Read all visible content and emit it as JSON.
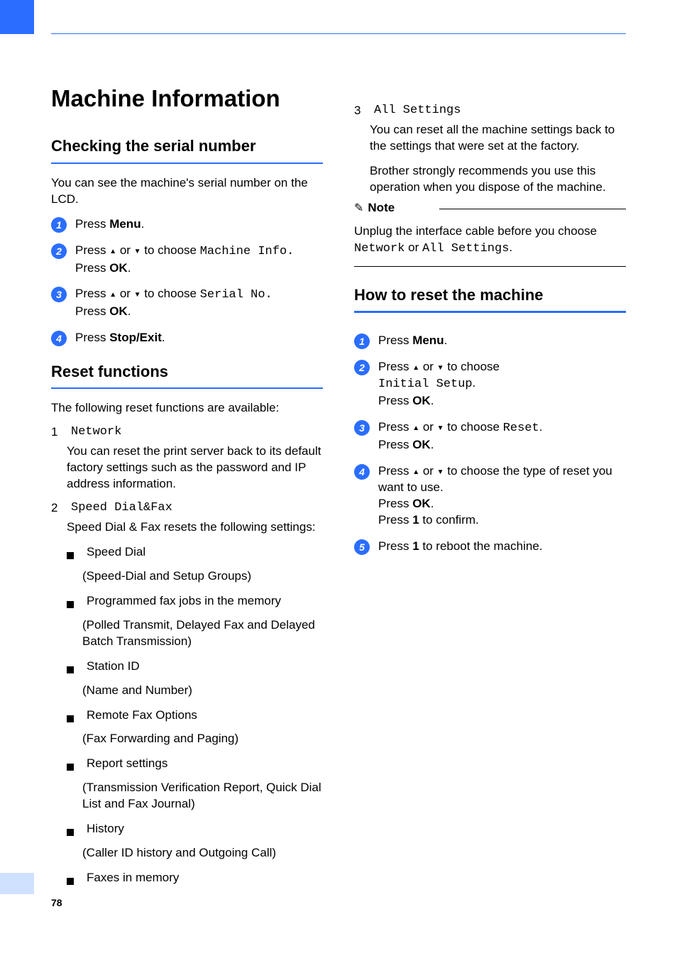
{
  "page_number": "78",
  "left": {
    "title": "Machine Information",
    "sect1": {
      "heading": "Checking the serial number",
      "intro": "You can see the machine's serial number on the LCD.",
      "steps": [
        {
          "pre": "Press ",
          "bold": "Menu",
          "post": "."
        },
        {
          "pre": "Press ",
          "arrow_text": " or ",
          "post_arrow": " to choose ",
          "mono": "Machine Info.",
          "line2_pre": "Press ",
          "line2_bold": "OK",
          "line2_post": "."
        },
        {
          "pre": "Press ",
          "arrow_text": " or ",
          "post_arrow": " to choose ",
          "mono": "Serial No.",
          "line2_pre": "Press ",
          "line2_bold": "OK",
          "line2_post": "."
        },
        {
          "pre": "Press ",
          "bold": "Stop/Exit",
          "post": "."
        }
      ]
    },
    "sect2": {
      "heading": "Reset functions",
      "intro": "The following reset functions are available:",
      "items": [
        {
          "n": "1",
          "mono": "Network",
          "desc": "You can reset the print server back to its default factory settings such as the password and IP address information."
        },
        {
          "n": "2",
          "mono": "Speed Dial&Fax",
          "desc": "Speed Dial & Fax resets the following settings:",
          "bullets": [
            {
              "label": "Speed Dial",
              "paren": "(Speed-Dial and Setup Groups)"
            },
            {
              "label": "Programmed fax jobs in the memory",
              "paren": "(Polled Transmit, Delayed Fax and Delayed Batch Transmission)"
            },
            {
              "label": "Station ID",
              "paren": "(Name and Number)"
            },
            {
              "label": "Remote Fax Options",
              "paren": "(Fax Forwarding and Paging)"
            },
            {
              "label": "Report settings",
              "paren": "(Transmission Verification Report, Quick Dial List and Fax Journal)"
            },
            {
              "label": "History",
              "paren": "(Caller ID history and Outgoing Call)"
            },
            {
              "label": "Faxes in memory",
              "paren": ""
            }
          ]
        }
      ]
    }
  },
  "right": {
    "cont_item": {
      "n": "3",
      "mono": "All Settings",
      "desc1": "You can reset all the machine settings back to the settings that were set at the factory.",
      "desc2": "Brother strongly recommends you use this operation when you dispose of the machine."
    },
    "note": {
      "label": "Note",
      "body_pre": "Unplug the interface cable before you choose ",
      "mono1": "Network",
      "mid": " or ",
      "mono2": "All Settings",
      "body_post": "."
    },
    "sect": {
      "heading": "How to reset the machine",
      "steps": [
        {
          "text_pre": "Press ",
          "bold1": "Menu",
          "text_post": "."
        },
        {
          "text_pre": "Press ",
          "arrow": true,
          "post_arrow": " to choose ",
          "mono_line": "Initial Setup",
          "mono_post": ".",
          "line3_pre": "Press ",
          "line3_bold": "OK",
          "line3_post": "."
        },
        {
          "text_pre": "Press ",
          "arrow": true,
          "post_arrow": " to choose ",
          "mono_inline": "Reset",
          "after_mono": ".",
          "line2_pre": "Press ",
          "line2_bold": "OK",
          "line2_post": "."
        },
        {
          "text_pre": "Press ",
          "arrow": true,
          "post_arrow": " to choose the type of reset you want to use.",
          "line2_pre": "Press ",
          "line2_bold": "OK",
          "line2_post": ".",
          "line3_pre": "Press ",
          "line3_bold": "1",
          "line3_post": " to confirm."
        },
        {
          "text_pre": "Press ",
          "bold1": "1",
          "text_post": " to reboot the machine."
        }
      ]
    }
  }
}
